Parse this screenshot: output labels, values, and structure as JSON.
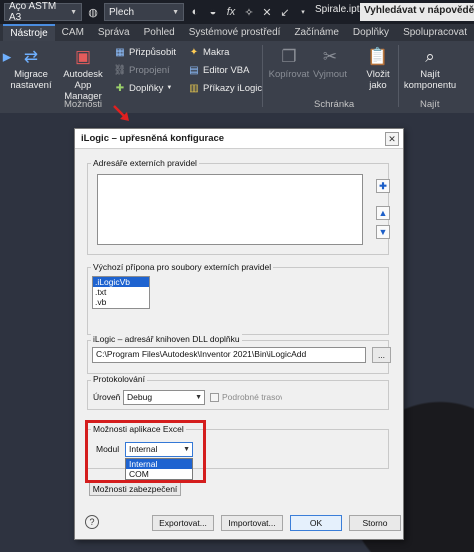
{
  "titlebar": {
    "material": "Aço ASTM A3",
    "appearance": "Plech",
    "fx_label": "fx",
    "filename": "Spirale.ipt",
    "search_placeholder": "Vyhledávat v nápovědě"
  },
  "tabs": [
    "Nástroje",
    "CAM",
    "Správa",
    "Pohled",
    "Systémové prostředí",
    "Začínáme",
    "Doplňky",
    "Spolupracovat"
  ],
  "active_tab": "Nástroje",
  "ribbon": {
    "migrate_settings": "Migrace nastavení",
    "app_manager": "Autodesk App Manager",
    "customize": "Přizpůsobit",
    "links": "Propojení",
    "addins": "Doplňky",
    "macros": "Makra",
    "vba_editor": "Editor VBA",
    "ilogic_commands": "Příkazy iLogic",
    "copy": "Kopírovat",
    "cut": "Vyjmout",
    "paste_as": "Vložit jako",
    "find_component": "Najít komponentu",
    "group_options": "Možnosti",
    "group_clipboard": "Schránka",
    "group_find": "Najít"
  },
  "dialog": {
    "title": "iLogic – upřesněná konfigurace",
    "close_glyph": "✕",
    "ext_rules_dirs_label": "Adresáře externích pravidel",
    "default_ext_label": "Výchozí přípona pro soubory externích pravidel",
    "extensions": [
      ".iLogicVb",
      ".txt",
      ".vb"
    ],
    "selected_extension": ".iLogicVb",
    "dll_dir_label": "iLogic – adresář knihoven DLL doplňku",
    "dll_path": "C:\\Program Files\\Autodesk\\Inventor 2021\\Bin\\iLogicAdd",
    "browse_label": "...",
    "logging_label": "Protokolování",
    "level_label": "Úroveň",
    "level_value": "Debug",
    "detailed_trace_label": "Podrobné trasování",
    "excel_options_label": "Možnosti aplikace Excel",
    "module_label": "Modul",
    "module_value": "Internal",
    "module_options": [
      "Internal",
      "COM"
    ],
    "security_button": "Možnosti zabezpečení",
    "export_button": "Exportovat...",
    "import_button": "Importovat...",
    "ok_button": "OK",
    "cancel_button": "Storno",
    "help_glyph": "?"
  },
  "colors": {
    "ribbon_bg": "#3b404b",
    "accent": "#1e63d0",
    "highlight_box": "#d41d1d"
  }
}
